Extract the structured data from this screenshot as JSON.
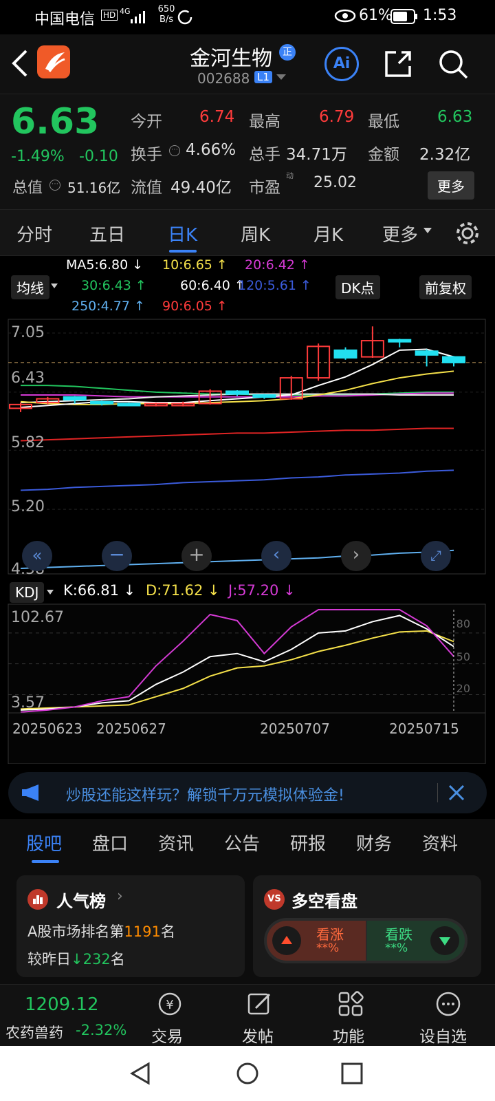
{
  "status": {
    "carrier": "中国电信",
    "hd": "HD",
    "net": "4G",
    "speed": "650\nB/s",
    "battery": "61%",
    "time": "1:53"
  },
  "nav": {
    "title": "金河生物",
    "badge": "正",
    "code": "002688",
    "level": "L1",
    "ai": "Ai"
  },
  "quote": {
    "price": "6.63",
    "change_pct": "-1.49%",
    "change": "-0.10",
    "open_label": "今开",
    "open": "6.74",
    "high_label": "最高",
    "high": "6.79",
    "low_label": "最低",
    "low": "6.63",
    "turnover_label": "换手",
    "turnover": "4.66%",
    "volume_label": "总手",
    "volume": "34.71万",
    "amount_label": "金额",
    "amount": "2.32亿",
    "mktcap_label": "总值",
    "mktcap": "51.16亿",
    "float_label": "流值",
    "float": "49.40亿",
    "pe_label": "市盈",
    "pe_sup": "动",
    "pe": "25.02",
    "more": "更多"
  },
  "tabs": [
    "分时",
    "五日",
    "日K",
    "周K",
    "月K",
    "更多"
  ],
  "active_tab": 2,
  "ma": {
    "ma5": "MA5:6.80 ↓",
    "ma10": "10:6.65 ↑",
    "ma20": "20:6.42 ↑",
    "ma30": "30:6.43 ↑",
    "ma60": "60:6.40 ↑",
    "ma120": "120:5.61 ↑",
    "ma250": "250:4.77 ↑",
    "ma90": "90:6.05 ↑",
    "btn_ma": "均线",
    "btn_dk": "DK点",
    "btn_adj": "前复权"
  },
  "price_axis": [
    "7.05",
    "6.43",
    "5.82",
    "5.20",
    "4.58"
  ],
  "kdj": {
    "label": "KDJ",
    "k": "K:66.81 ↓",
    "d": "D:71.62 ↓",
    "j": "J:57.20 ↓",
    "top": "102.67",
    "bottom": "3.57",
    "ticks": [
      "80",
      "50",
      "20"
    ]
  },
  "dates": [
    "20250623",
    "20250627",
    "20250707",
    "20250715"
  ],
  "ad": {
    "text": "炒股还能这样玩？解锁千万元模拟体验金!"
  },
  "subtabs": [
    "股吧",
    "盘口",
    "资讯",
    "公告",
    "研报",
    "财务",
    "资料"
  ],
  "popularity": {
    "title": "人气榜",
    "line1_pre": "A股市场排名第",
    "rank": "1191",
    "line1_post": "名",
    "line2_pre": "较昨日",
    "delta": "232",
    "line2_post": "名"
  },
  "bullbear": {
    "title": "多空看盘",
    "bull": "看涨",
    "bull_val": "**%",
    "bear": "看跌",
    "bear_val": "**%"
  },
  "bottom": {
    "index_val": "1209.12",
    "index_name": "农药兽药",
    "index_pct": "-2.32%",
    "trade": "交易",
    "post": "发帖",
    "func": "功能",
    "watch": "设自选"
  },
  "colors": {
    "up": "#ff3b3b",
    "down": "#22c55e",
    "accent": "#3b82f6",
    "cyan": "#22e0f0"
  },
  "chart_data": {
    "type": "candlestick",
    "candles": [
      {
        "o": 6.26,
        "c": 6.3,
        "h": 6.32,
        "l": 6.22
      },
      {
        "o": 6.32,
        "c": 6.36,
        "h": 6.38,
        "l": 6.3
      },
      {
        "o": 6.38,
        "c": 6.35,
        "h": 6.39,
        "l": 6.31
      },
      {
        "o": 6.33,
        "c": 6.31,
        "h": 6.34,
        "l": 6.29
      },
      {
        "o": 6.31,
        "c": 6.3,
        "h": 6.32,
        "l": 6.29
      },
      {
        "o": 6.29,
        "c": 6.31,
        "h": 6.32,
        "l": 6.28
      },
      {
        "o": 6.29,
        "c": 6.31,
        "h": 6.33,
        "l": 6.28
      },
      {
        "o": 6.31,
        "c": 6.44,
        "h": 6.46,
        "l": 6.3
      },
      {
        "o": 6.44,
        "c": 6.41,
        "h": 6.45,
        "l": 6.39
      },
      {
        "o": 6.4,
        "c": 6.38,
        "h": 6.41,
        "l": 6.36
      },
      {
        "o": 6.36,
        "c": 6.58,
        "h": 6.6,
        "l": 6.35
      },
      {
        "o": 6.58,
        "c": 6.91,
        "h": 6.94,
        "l": 6.55
      },
      {
        "o": 6.87,
        "c": 6.79,
        "h": 6.9,
        "l": 6.77
      },
      {
        "o": 6.8,
        "c": 6.97,
        "h": 7.12,
        "l": 6.79
      },
      {
        "o": 6.98,
        "c": 6.97,
        "h": 6.99,
        "l": 6.9
      },
      {
        "o": 6.86,
        "c": 6.82,
        "h": 6.88,
        "l": 6.7
      },
      {
        "o": 6.8,
        "c": 6.74,
        "h": 6.81,
        "l": 6.7
      }
    ],
    "ma5": [
      6.27,
      6.29,
      6.31,
      6.33,
      6.33,
      6.32,
      6.32,
      6.34,
      6.36,
      6.38,
      6.4,
      6.5,
      6.59,
      6.72,
      6.87,
      6.88,
      6.8
    ],
    "ma10": [
      6.33,
      6.31,
      6.3,
      6.3,
      6.31,
      6.31,
      6.31,
      6.32,
      6.33,
      6.34,
      6.36,
      6.4,
      6.45,
      6.52,
      6.58,
      6.62,
      6.65
    ],
    "ma20": [
      6.4,
      6.4,
      6.4,
      6.39,
      6.38,
      6.38,
      6.38,
      6.38,
      6.38,
      6.38,
      6.38,
      6.39,
      6.39,
      6.4,
      6.41,
      6.42,
      6.42
    ],
    "ma30": [
      6.5,
      6.5,
      6.49,
      6.47,
      6.45,
      6.43,
      6.42,
      6.41,
      6.41,
      6.4,
      6.4,
      6.4,
      6.4,
      6.41,
      6.42,
      6.43,
      6.43
    ],
    "ma60": [
      6.32,
      6.33,
      6.34,
      6.35,
      6.36,
      6.38,
      6.39,
      6.4,
      6.41,
      6.41,
      6.41,
      6.41,
      6.41,
      6.41,
      6.4,
      6.4,
      6.4
    ],
    "ma90": [
      5.92,
      5.93,
      5.94,
      5.95,
      5.96,
      5.97,
      5.98,
      5.99,
      6.0,
      6.0,
      6.01,
      6.02,
      6.03,
      6.03,
      6.04,
      6.05,
      6.05
    ],
    "ma120": [
      5.4,
      5.41,
      5.43,
      5.44,
      5.45,
      5.46,
      5.48,
      5.49,
      5.5,
      5.51,
      5.53,
      5.54,
      5.56,
      5.57,
      5.58,
      5.6,
      5.61
    ],
    "ma250": [
      4.58,
      4.59,
      4.6,
      4.61,
      4.62,
      4.63,
      4.64,
      4.65,
      4.66,
      4.67,
      4.68,
      4.69,
      4.71,
      4.72,
      4.74,
      4.75,
      4.77
    ],
    "k": [
      5,
      6,
      8,
      12,
      14,
      30,
      42,
      57,
      60,
      52,
      64,
      80,
      82,
      91,
      97,
      84,
      66.81
    ],
    "d": [
      6,
      7,
      8,
      9,
      10,
      18,
      26,
      38,
      46,
      48,
      54,
      62,
      68,
      75,
      81,
      82,
      71.62
    ],
    "j": [
      3,
      5,
      8,
      14,
      18,
      48,
      72,
      98,
      92,
      60,
      86,
      112,
      104,
      114,
      118,
      87,
      57.2
    ],
    "price_range": [
      4.58,
      7.05
    ],
    "kdj_range": [
      3.57,
      102.67
    ]
  }
}
